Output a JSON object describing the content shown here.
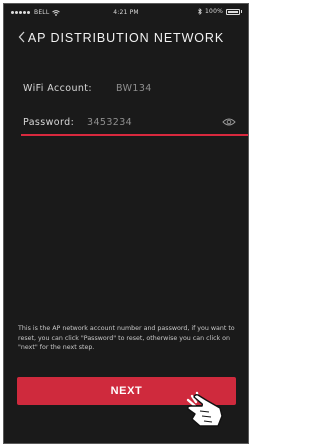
{
  "status_bar": {
    "carrier": "BELL",
    "time": "4:21 PM",
    "battery": "100%"
  },
  "header": {
    "title": "AP DISTRIBUTION NETWORK",
    "back_icon": "chevron-left-icon"
  },
  "form": {
    "account_label": "WiFi Account:",
    "account_value": "BW134",
    "password_label": "Password:",
    "password_value": "3453234",
    "eye_icon": "eye-icon"
  },
  "info_text": "This is the AP network account number and password, if you want to reset, you can click \"Password\" to reset, otherwise you can click on \"next\" for the next step.",
  "next_button_label": "NEXT",
  "colors": {
    "background": "#1a1a1a",
    "accent": "#cf2a3d",
    "underline": "#d8293e"
  },
  "pointer_icon": "hand-pointer-icon"
}
